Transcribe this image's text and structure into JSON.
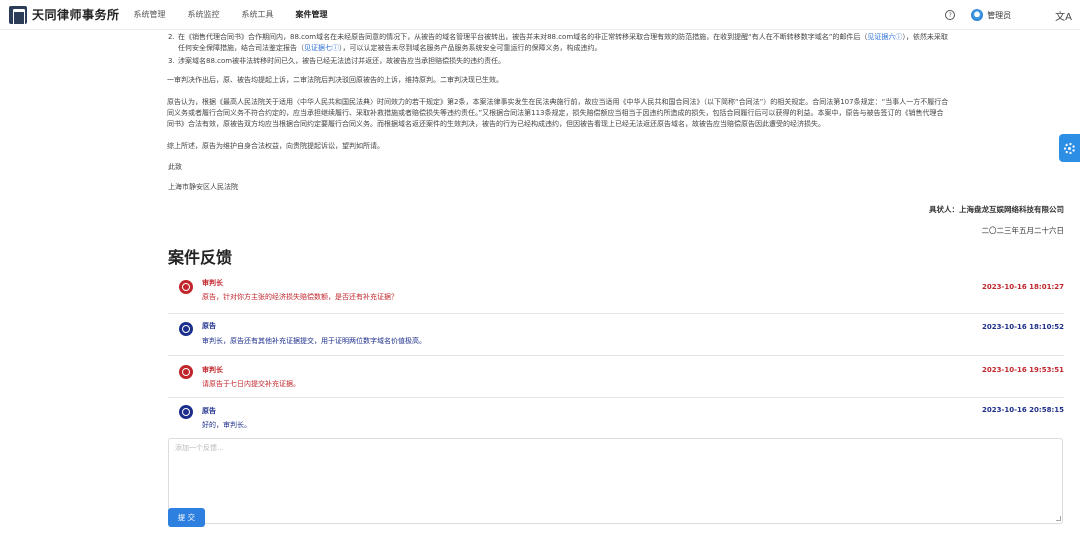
{
  "app": {
    "name": "天同律师事务所",
    "nav": [
      "系统管理",
      "系统监控",
      "系统工具",
      "案件管理"
    ],
    "active_nav": "案件管理",
    "user": "管理员",
    "help_icon": "help-circle-icon",
    "translate_icon": "translate-icon",
    "translate_glyph": "文A",
    "help_glyph": "?"
  },
  "document": {
    "item2_num": "2.",
    "item2_line1": "在《销售代理合同书》合作期间内，88.com域名在未经原告同意的情况下，从被告的域名管理平台被转出，被告并未对88.com域名的非正常转移采取合理有效的防范措施，在收到提醒“有人在不断转移数字域名”的邮件后（",
    "item2_link1": "见证据六",
    "item2_line1_end": "），依然未采取",
    "item2_line2": "任何安全保障措施，结合司法鉴定报告（",
    "item2_link2": "见证据七",
    "item2_line2_end": "），可以认定被告未尽到域名服务产品服务系统安全可靠运行的保障义务，构成违约。",
    "item3_num": "3.",
    "item3": "涉案域名88.com被非法转移时间已久，被告已经无法追讨并返还，故被告应当承担赔偿损失的违约责任。",
    "para1": "一审判决作出后，原、被告均提起上诉，二审法院后判决驳回原被告的上诉，维持原判。二审判决现已生效。",
    "para2_line1": "原告认为，根据《最高人民法院关于适用〈中华人民共和国民法典〉时间效力的若干规定》第2条，本案法律事实发生在民法典施行前，故应当适用《中华人民共和国合同法》（以下简称“合同法”）的相关规定。合同法第107条规定：“当事人一方不履行合",
    "para2_line2": "同义务或者履行合同义务不符合约定的，应当承担继续履行、采取补救措施或者赔偿损失等违约责任。”又根据合同法第113条规定，损失赔偿额应当相当于因违约所造成的损失，包括合同履行后可以获得的利益。本案中，原告与被告签订的《销售代理合",
    "para2_line3": "同书》合法有效，原被告双方均应当根据合同约定要履行合同义务。而根据域名返还案件的生效判决，被告的行为已经构成违约，但因被告看现上已经无法返还原告域名，故被告应当赔偿原告因此遭受的经济损失。",
    "para3": "综上所述，原告为维护自身合法权益，向贵院提起诉讼，望判如所请。",
    "para4": "此致",
    "court": "上海市静安区人民法院",
    "signer": "具状人：上海盘龙互娱网络科技有限公司",
    "date": "二〇二三年五月二十六日"
  },
  "feedback": {
    "title": "案件反馈",
    "items": [
      {
        "role": "judge",
        "author": "审判长",
        "message": "原告，针对你方主张的经济损失赔偿数额，是否还有补充证据？",
        "time": "2023-10-16 18:01:27",
        "icon": "judge-seal-icon"
      },
      {
        "role": "plaintiff",
        "author": "原告",
        "message": "审判长，原告还有其他补充证据提交，用于证明两位数字域名价值极高。",
        "time": "2023-10-16 18:10:52",
        "icon": "plaintiff-seal-icon"
      },
      {
        "role": "judge",
        "author": "审判长",
        "message": "请原告于七日内提交补充证据。",
        "time": "2023-10-16 19:53:51",
        "icon": "judge-seal-icon"
      },
      {
        "role": "plaintiff",
        "author": "原告",
        "message": "好的，审判长。",
        "time": "2023-10-16 20:58:15",
        "icon": "plaintiff-seal-icon"
      }
    ],
    "input_placeholder": "添加一个反馈...",
    "submit_label": "提 交"
  },
  "colors": {
    "judge": "#c0262c",
    "plaintiff": "#1d2f8c",
    "accent": "#2d7fe0"
  },
  "float_button_icon": "settings-gear-icon"
}
